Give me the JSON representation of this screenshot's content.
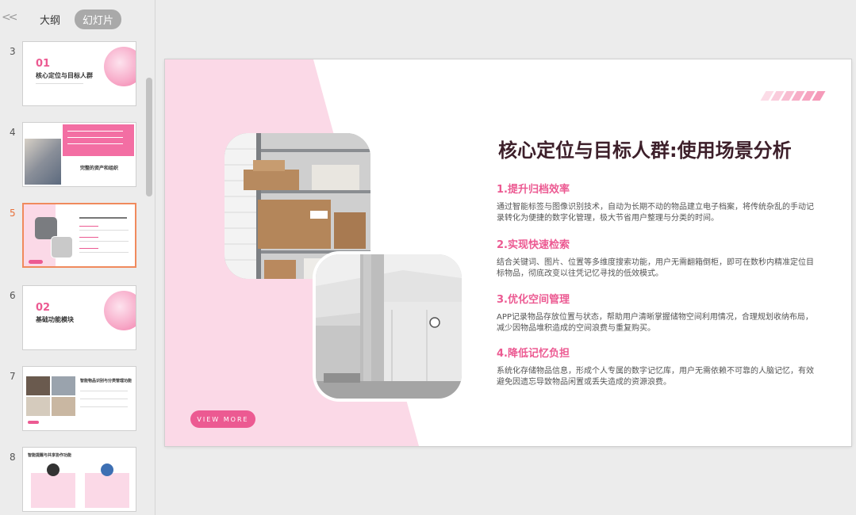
{
  "panel": {
    "collapse_glyph": "<<",
    "tabs": [
      {
        "label": "大纲",
        "active": false
      },
      {
        "label": "幻灯片",
        "active": true
      }
    ]
  },
  "thumbnails": [
    {
      "num": "3",
      "title_num": "01",
      "title": "核心定位与目标人群"
    },
    {
      "num": "4",
      "title": "完整的资产和组织"
    },
    {
      "num": "5",
      "active": true
    },
    {
      "num": "6",
      "title_num": "02",
      "title": "基础功能模块"
    },
    {
      "num": "7",
      "title": "智能物品识别与分类管理功能"
    },
    {
      "num": "8",
      "title": "智能提醒与共享协作功能"
    }
  ],
  "slide": {
    "title": "核心定位与目标人群:使用场景分析",
    "sections": [
      {
        "heading": "1.提升归档效率",
        "body": "通过智能标签与图像识别技术，自动为长期不动的物品建立电子档案，将传统杂乱的手动记录转化为便捷的数字化管理，极大节省用户整理与分类的时间。"
      },
      {
        "heading": "2.实现快速检索",
        "body": "结合关键词、图片、位置等多维度搜索功能，用户无需翻箱倒柜，即可在数秒内精准定位目标物品，彻底改变以往凭记忆寻找的低效模式。"
      },
      {
        "heading": "3.优化空间管理",
        "body": "APP记录物品存放位置与状态，帮助用户清晰掌握储物空间利用情况，合理规划收纳布局，减少因物品堆积造成的空间浪费与重复购买。"
      },
      {
        "heading": "4.降低记忆负担",
        "body": "系统化存储物品信息，形成个人专属的数字记忆库，用户无需依赖不可靠的人脑记忆，有效避免因遗忘导致物品闲置或丢失造成的资源浪费。"
      }
    ],
    "view_more": "VIEW MORE"
  },
  "colors": {
    "accent": "#ec5a92",
    "accent_light": "#fbd9e7",
    "title": "#3d1f2a",
    "active_thumb_border": "#f08a5d"
  }
}
